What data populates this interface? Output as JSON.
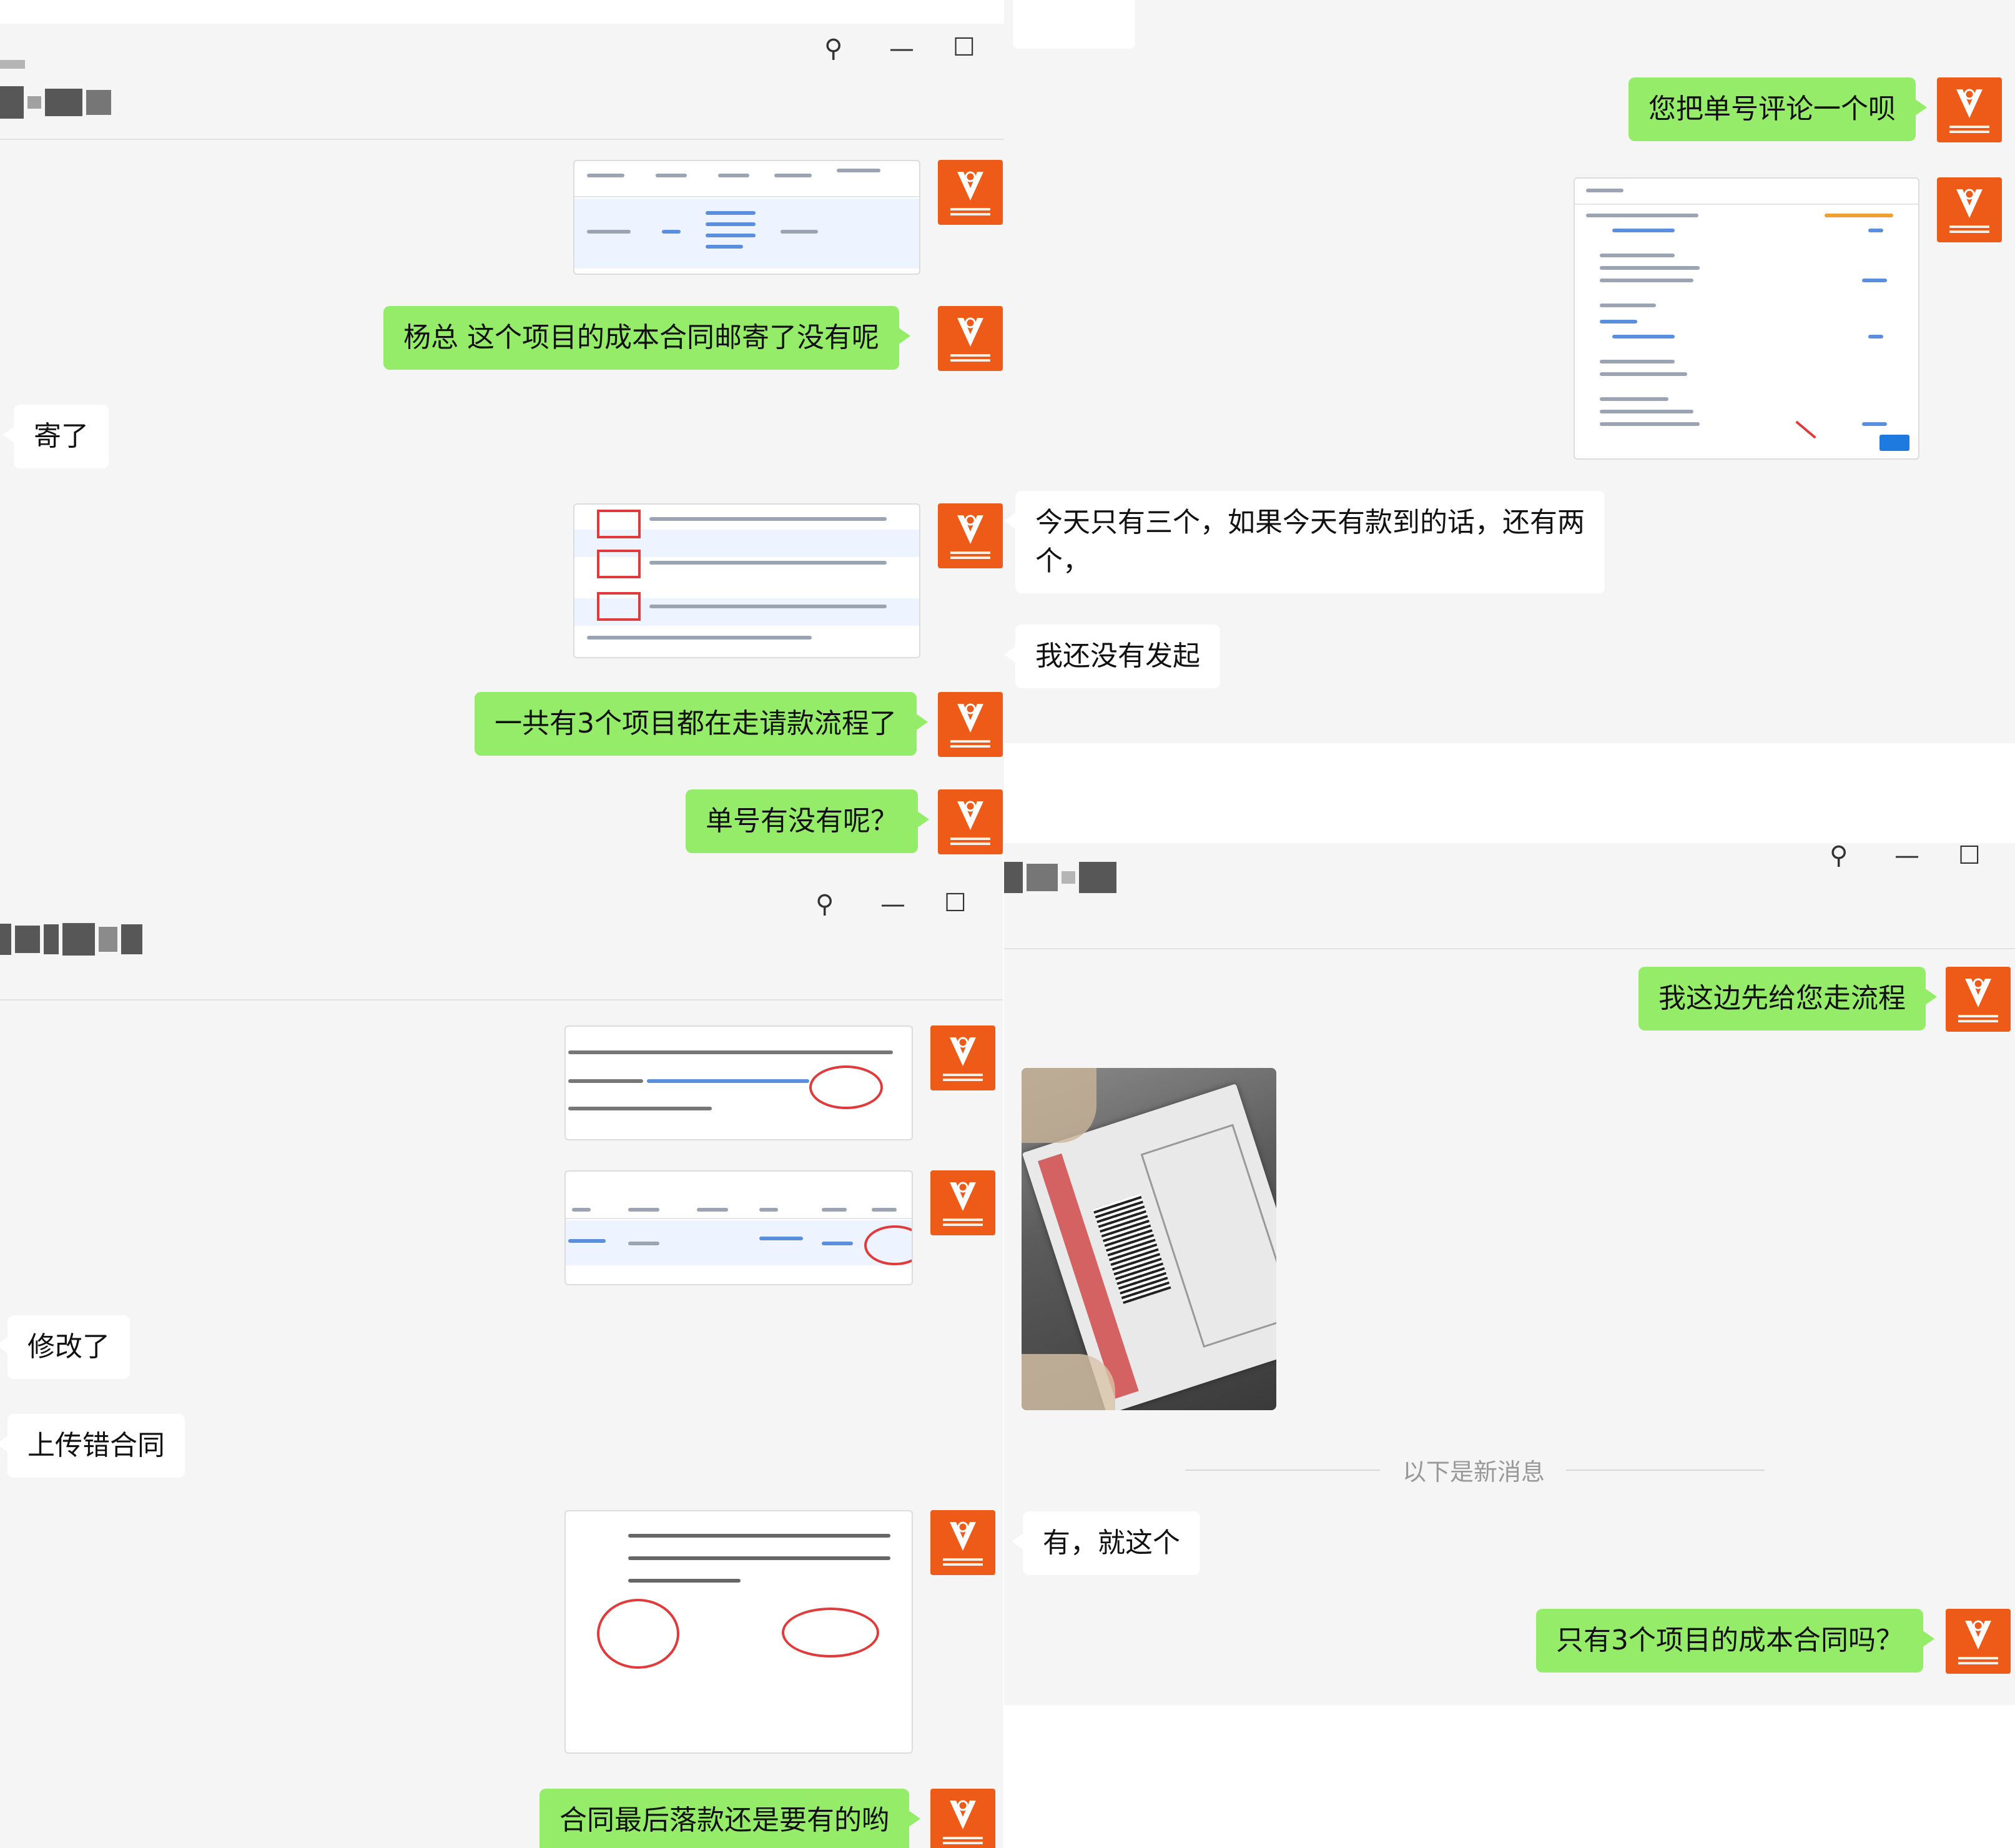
{
  "colors": {
    "bubble_self": "#95ec69",
    "bubble_other": "#ffffff",
    "panel_bg": "#f5f5f5",
    "avatar": "#ee5a17",
    "annotation": "#e23a3a"
  },
  "icons": {
    "pin": "pin-icon",
    "minimize": "minimize-icon",
    "maximize": "maximize-icon",
    "avatar": "company-logo-avatar"
  },
  "window_controls": {
    "pin": "⚲",
    "minimize": "—",
    "maximize": "☐"
  },
  "panel1": {
    "messages": {
      "m1": "杨总    这个项目的成本合同邮寄了没有呢",
      "m2": "寄了",
      "m3": "一共有3个项目都在走请款流程了",
      "m4": "单号有没有呢？"
    }
  },
  "panel2": {
    "messages": {
      "m1": "您把单号评论一个呗",
      "m2_line1": "今天只有三个，如果今天有款到的话，还有两",
      "m2_line2": "个，",
      "m3": "我还没有发起"
    }
  },
  "panel3": {
    "messages": {
      "m1": "修改了",
      "m2": "上传错合同",
      "m3": "合同最后落款还是要有的哟"
    }
  },
  "panel4": {
    "messages": {
      "m1": "我这边先给您走流程",
      "m2": "有，就这个",
      "m3": "只有3个项目的成本合同吗？"
    },
    "new_message_divider": "以下是新消息"
  }
}
